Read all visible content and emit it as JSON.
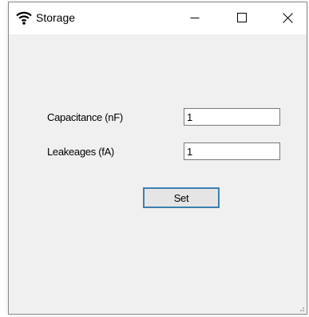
{
  "window": {
    "title": "Storage",
    "icon": "wifi-icon"
  },
  "form": {
    "capacitance_label": "Capacitance (nF)",
    "capacitance_value": "1",
    "leakages_label": "Leakeages (fA)",
    "leakages_value": "1",
    "set_label": "Set"
  },
  "colors": {
    "titlebar": "#ffffff",
    "client_background": "#f0f0f0",
    "button_border": "#3c7fb1",
    "button_face": "#e5e5e5"
  }
}
